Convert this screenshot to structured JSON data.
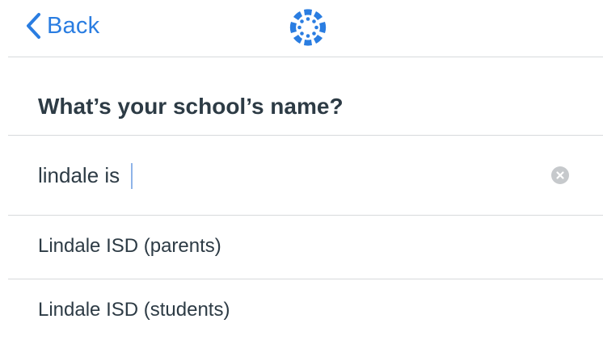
{
  "nav": {
    "back_label": "Back"
  },
  "page": {
    "heading": "What’s your school’s name?"
  },
  "search": {
    "value": "lindale is",
    "placeholder": ""
  },
  "results": [
    {
      "label": "Lindale ISD (parents)"
    },
    {
      "label": "Lindale ISD (students)"
    }
  ],
  "colors": {
    "accent": "#2a7de1",
    "text": "#2d3b45",
    "divider": "#d7dadc",
    "clear_icon_bg": "#c6c9cc"
  },
  "icons": {
    "back": "chevron-left-icon",
    "logo": "canvas-logo-icon",
    "clear": "clear-icon"
  }
}
